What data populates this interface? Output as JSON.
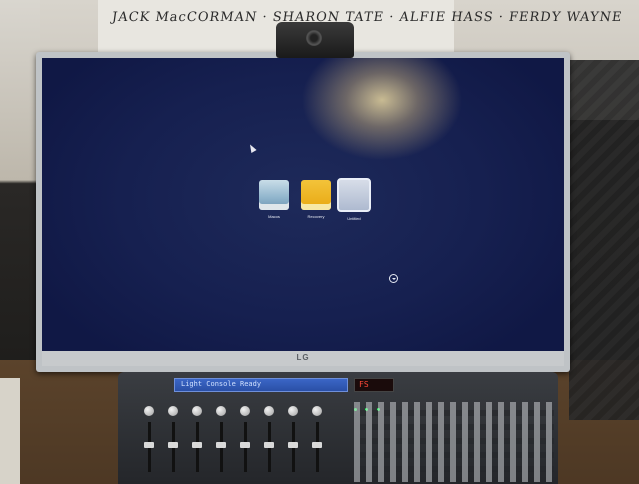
{
  "photo": {
    "poster_text": "JACK MacCORMAN · SHARON TATE · ALFIE HASS · FERDY WAYNE",
    "monitor_brand": "LG",
    "screen": {
      "volumes": [
        {
          "label": "Macos",
          "icon": "disk-icon-macos"
        },
        {
          "label": "Recovery",
          "icon": "disk-icon-recovery"
        },
        {
          "label": "Untitled",
          "icon": "disk-icon-selected"
        }
      ],
      "selected_indicator_icon": "arrow-down-circle-icon"
    },
    "console": {
      "display_text": "Light Console Ready",
      "led_text": "FS"
    }
  },
  "colors": {
    "screen_bg": "#162050",
    "bezel": "#c7cacc",
    "desk": "#5b432b",
    "console": "#2f3237",
    "console_display": "#3b66c6",
    "led": "#ff4a3a"
  }
}
